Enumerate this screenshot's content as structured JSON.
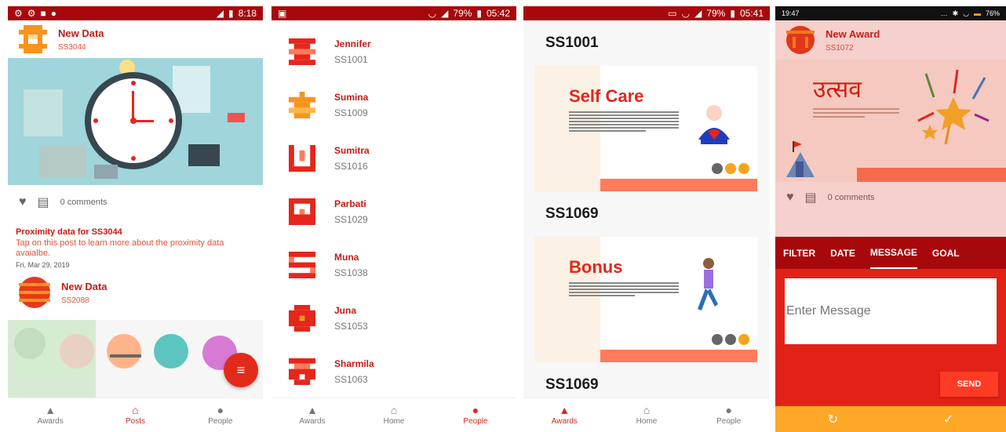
{
  "theme": {
    "primary": "#a7080c",
    "accent": "#e22a1a",
    "nav_active": "#d62a1c",
    "footer": "#ffa726"
  },
  "screen1": {
    "status": {
      "time": "8:18"
    },
    "posts": [
      {
        "title": "New Data",
        "subtitle": "SS3044"
      },
      {
        "title": "New Data",
        "subtitle": "SS2088"
      }
    ],
    "comments": "0 comments",
    "post_title": "Proximity data for SS3044",
    "post_body": "Tap on this post to learn more about the proximity data avaialbe.",
    "post_date": "Fri, Mar 29, 2019",
    "fab_icon": "filter-icon",
    "nav": [
      {
        "label": "Awards",
        "icon": "mountain-icon"
      },
      {
        "label": "Posts",
        "icon": "home-icon"
      },
      {
        "label": "People",
        "icon": "person-icon"
      }
    ]
  },
  "screen2": {
    "status": {
      "battery": "79%",
      "time": "05:42"
    },
    "people": [
      {
        "name": "Jennifer",
        "id": "SS1001"
      },
      {
        "name": "Sumina",
        "id": "SS1009"
      },
      {
        "name": "Sumitra",
        "id": "SS1016"
      },
      {
        "name": "Parbati",
        "id": "SS1029"
      },
      {
        "name": "Muna",
        "id": "SS1038"
      },
      {
        "name": "Juna",
        "id": "SS1053"
      },
      {
        "name": "Sharmila",
        "id": "SS1063"
      }
    ],
    "nav": [
      {
        "label": "Awards",
        "icon": "mountain-icon"
      },
      {
        "label": "Home",
        "icon": "home-icon"
      },
      {
        "label": "People",
        "icon": "person-icon"
      }
    ]
  },
  "screen3": {
    "status": {
      "battery": "79%",
      "time": "05:41"
    },
    "awards": [
      {
        "code": "SS1001",
        "name": "Self Care"
      },
      {
        "code": "SS1069",
        "name": "Bonus"
      },
      {
        "code": "SS1069"
      }
    ],
    "nav": [
      {
        "label": "Awards",
        "icon": "mountain-icon"
      },
      {
        "label": "Home",
        "icon": "home-icon"
      },
      {
        "label": "People",
        "icon": "person-icon"
      }
    ]
  },
  "screen4": {
    "status": {
      "time": "19:47",
      "battery": "76%"
    },
    "award": {
      "title": "New Award",
      "subtitle": "SS1072",
      "image_title": "उत्सव"
    },
    "comments": "0 comments",
    "tabs": [
      "FILTER",
      "DATE",
      "MESSAGE",
      "GOAL"
    ],
    "message_placeholder": "Enter Message",
    "send_label": "SEND",
    "footer": {
      "refresh_icon": "refresh-icon",
      "confirm_icon": "check-icon"
    }
  }
}
